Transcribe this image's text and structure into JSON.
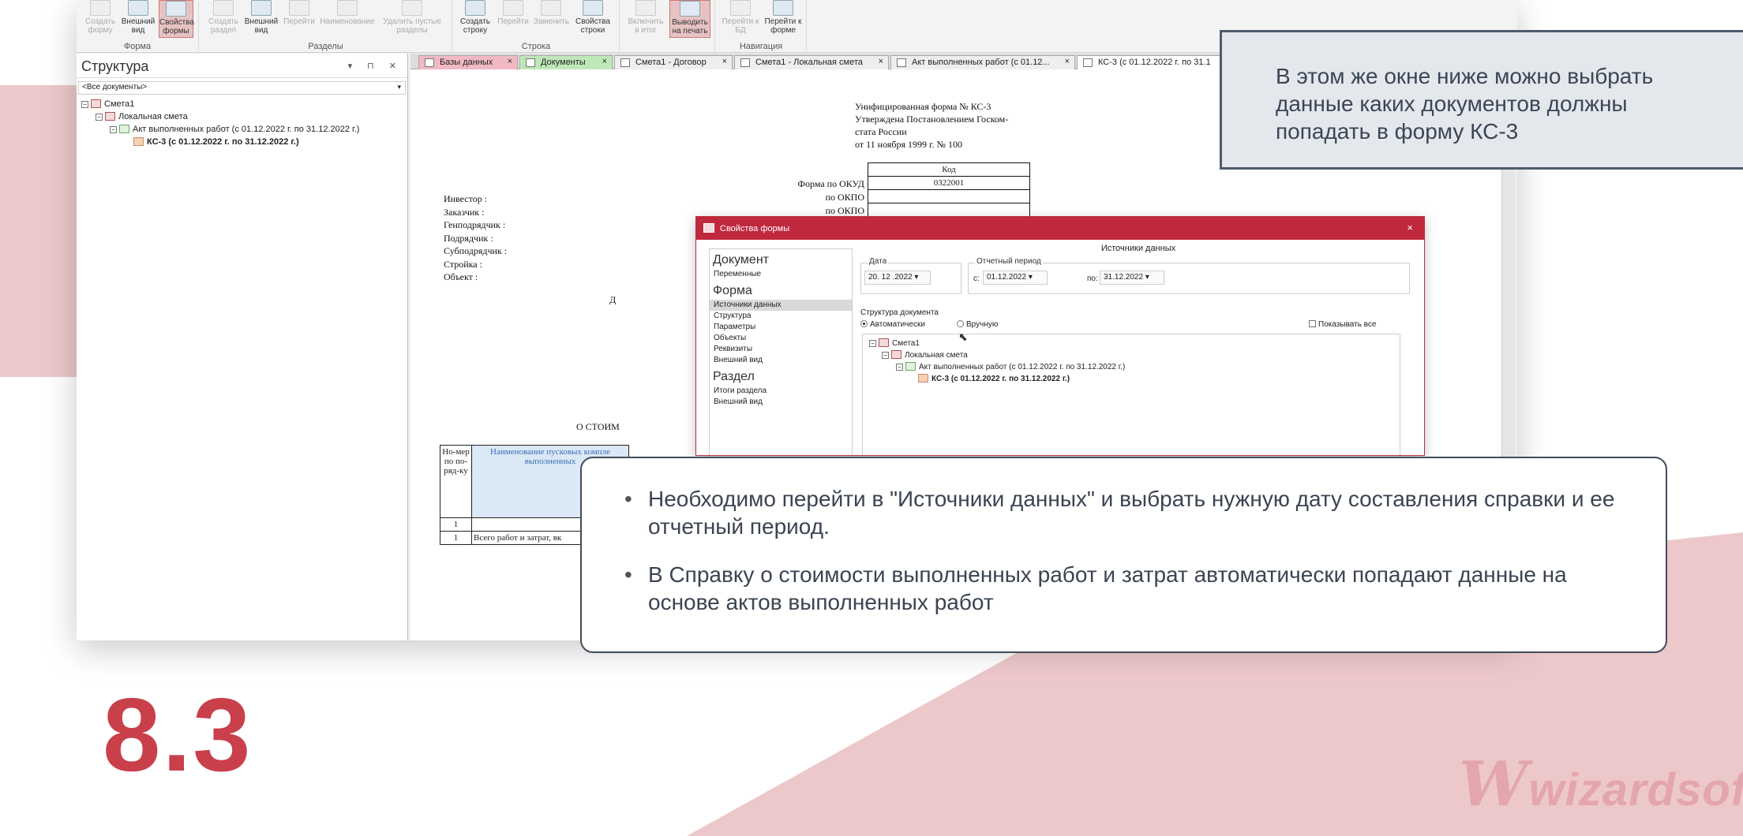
{
  "ribbon": {
    "groups": [
      {
        "label": "Форма",
        "buttons": [
          "Создать форму",
          "Внешний вид",
          "Свойства формы"
        ]
      },
      {
        "label": "Разделы",
        "buttons": [
          "Создать раздел",
          "Внешний вид",
          "Перейти",
          "Наименование",
          "Удалить пустые разделы"
        ]
      },
      {
        "label": "Строка",
        "buttons": [
          "Создать строку",
          "Перейти",
          "Заменить",
          "Свойства строки"
        ]
      },
      {
        "label": "",
        "buttons": [
          "Включить в итог",
          "Выводить на печать"
        ]
      },
      {
        "label": "Навигация",
        "buttons": [
          "Перейти к БД",
          "Перейти к форме"
        ]
      }
    ]
  },
  "sidebar": {
    "title": "Структура",
    "filter": "<Все документы>",
    "tree": [
      "Смета1",
      "Локальная смета",
      "Акт выполненных работ (с 01.12.2022 г. по 31.12.2022 г.)",
      "КС-3 (с 01.12.2022 г. по 31.12.2022 г.)"
    ]
  },
  "tabs": [
    "Базы данных",
    "Документы",
    "Смета1 - Договор",
    "Смета1 - Локальная смета",
    "Акт выполненных работ (с 01.12...",
    "КС-3 (с 01.12.2022 г. по 31.1"
  ],
  "document": {
    "header": [
      "Унифицированная форма № КС-3",
      "Утверждена Постановлением Госком-",
      "стата России",
      "от 11 ноября 1999 г. № 100"
    ],
    "kod_label": "Код",
    "okud_label": "Форма по ОКУД",
    "okud_value": "0322001",
    "okpo_label": "по ОКПО",
    "parties": [
      "Инвестор :",
      "Заказчик :",
      "Генподрядчик :",
      "Подрядчик :",
      "Субподрядчик :",
      "Стройка :",
      "Объект :"
    ],
    "fragment_d": "Д",
    "fragment_title": "О СТОИМ",
    "col_num": "Но-мер по по-ряд-ку",
    "col_name": "Наименование пусковых компле выполненных",
    "row1_num": "1",
    "row2_num": "1",
    "row2_text": "Всего работ и затрат, вк"
  },
  "dialog": {
    "title": "Свойства формы",
    "close": "×",
    "nav_sections": [
      {
        "title": "Документ",
        "items": [
          "Переменные"
        ]
      },
      {
        "title": "Форма",
        "items": [
          "Источники данных",
          "Структура",
          "Параметры",
          "Объекты",
          "Реквизиты",
          "Внешний вид"
        ]
      },
      {
        "title": "Раздел",
        "items": [
          "Итоги раздела",
          "Внешний вид"
        ]
      }
    ],
    "selected_item": "Источники данных",
    "header": "Источники данных",
    "date_label": "Дата",
    "date_value": "20. 12 .2022",
    "period_label": "Отчетный период",
    "from_label": "с:",
    "from_value": "01.12.2022",
    "to_label": "по:",
    "to_value": "31.12.2022",
    "structure_label": "Структура документа",
    "mode_auto": "Автоматически",
    "mode_manual": "Вручную",
    "show_all": "Показывать все",
    "tree": [
      "Смета1",
      "Локальная смета",
      "Акт выполненных работ (с 01.12.2022 г. по 31.12.2022 г.)",
      "КС-3 (с 01.12.2022 г. по 31.12.2022 г.)"
    ]
  },
  "callout_top": "В этом же окне ниже можно выбрать данные каких документов должны попадать в форму КС-3",
  "notes": [
    "Необходимо перейти в \"Источники данных\" и выбрать нужную дату составления справки и ее отчетный период.",
    "В Справку о стоимости выполненных работ и затрат автоматически попадают данные на основе актов выполненных работ"
  ],
  "version": "8.3",
  "brand": "wizardsoft",
  "colors": {
    "accent": "#c9404a",
    "pink_bg": "#edc8ca",
    "dialog_title": "#c0283d"
  }
}
